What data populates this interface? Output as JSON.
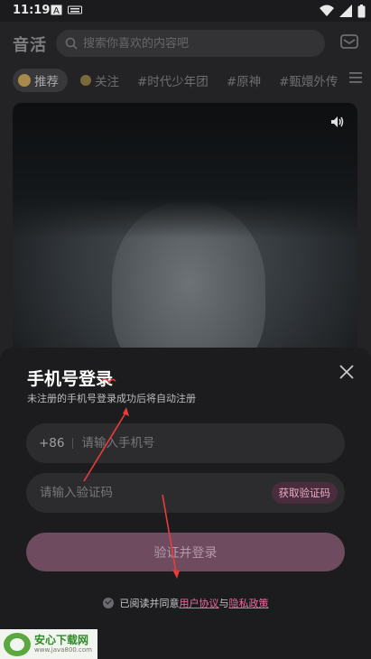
{
  "status_bar": {
    "time": "11:19"
  },
  "app": {
    "logo": "音活",
    "search_placeholder": "搜索你喜欢的内容吧",
    "tabs": [
      {
        "label": "推荐"
      },
      {
        "label": "关注"
      },
      {
        "label": "#时代少年团"
      },
      {
        "label": "#原神"
      },
      {
        "label": "#甄嬛外传"
      }
    ]
  },
  "login_sheet": {
    "title": "手机号登录",
    "subtitle": "未注册的手机号登录成功后将自动注册",
    "country_code": "+86",
    "phone_placeholder": "请输入手机号",
    "code_placeholder": "请输入验证码",
    "get_code_label": "获取验证码",
    "submit_label": "验证并登录",
    "agree_prefix": "已阅读并同意",
    "user_agreement": "用户协议",
    "and": "与",
    "privacy_policy": "隐私政策"
  },
  "watermark": {
    "name": "安心下载网",
    "url": "www.java800.com"
  },
  "colors": {
    "accent": "#ec6c9e",
    "annotation": "#e83c3c",
    "sheet_bg": "#1c1c1e"
  }
}
